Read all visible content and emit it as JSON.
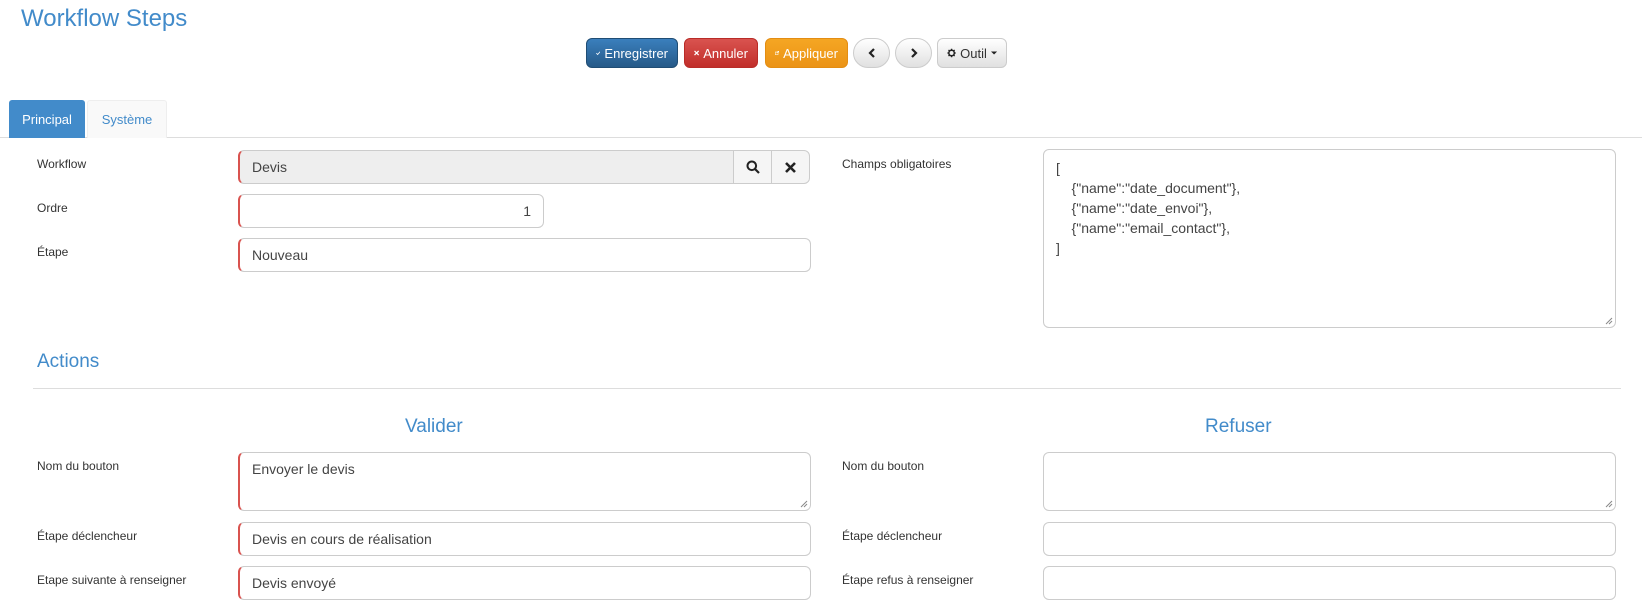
{
  "page": {
    "title": "Workflow Steps"
  },
  "toolbar": {
    "save_label": "Enregistrer",
    "cancel_label": "Annuler",
    "apply_label": "Appliquer",
    "tool_label": "Outil"
  },
  "tabs": [
    {
      "label": "Principal",
      "active": true
    },
    {
      "label": "Système",
      "active": false
    }
  ],
  "form": {
    "workflow": {
      "label": "Workflow",
      "value": "Devis"
    },
    "ordre": {
      "label": "Ordre",
      "value": "1"
    },
    "etape": {
      "label": "Étape",
      "value": "Nouveau"
    },
    "champs_obligatoires": {
      "label": "Champs obligatoires",
      "lines": [
        "[",
        "    {\"name\":\"date_document\"},",
        "    {\"name\":\"date_envoi\"},",
        "    {\"name\":\"email_contact\"},",
        "]"
      ]
    }
  },
  "actions": {
    "title": "Actions",
    "valider": {
      "title": "Valider",
      "nom_bouton": {
        "label": "Nom du bouton",
        "value": "Envoyer le devis"
      },
      "etape_declencheur": {
        "label": "Étape déclencheur",
        "value": "Devis en cours de réalisation"
      },
      "etape_suivante": {
        "label": "Etape suivante à renseigner",
        "value": "Devis envoyé"
      }
    },
    "refuser": {
      "title": "Refuser",
      "nom_bouton": {
        "label": "Nom du bouton",
        "value": ""
      },
      "etape_declencheur": {
        "label": "Étape déclencheur",
        "value": ""
      },
      "etape_refus": {
        "label": "Étape refus à renseigner",
        "value": ""
      }
    }
  },
  "icons": {
    "save": "check-icon",
    "cancel": "times-icon",
    "apply": "share-icon",
    "prev": "chevron-left-icon",
    "next": "chevron-right-icon",
    "tool": "gear-icon",
    "search": "search-icon",
    "clear": "times-icon"
  },
  "colors": {
    "accent": "#428bca",
    "primary": "#2e6da4",
    "danger": "#d9534f",
    "warning": "#f0ad4e",
    "required_border": "#d9534f"
  }
}
